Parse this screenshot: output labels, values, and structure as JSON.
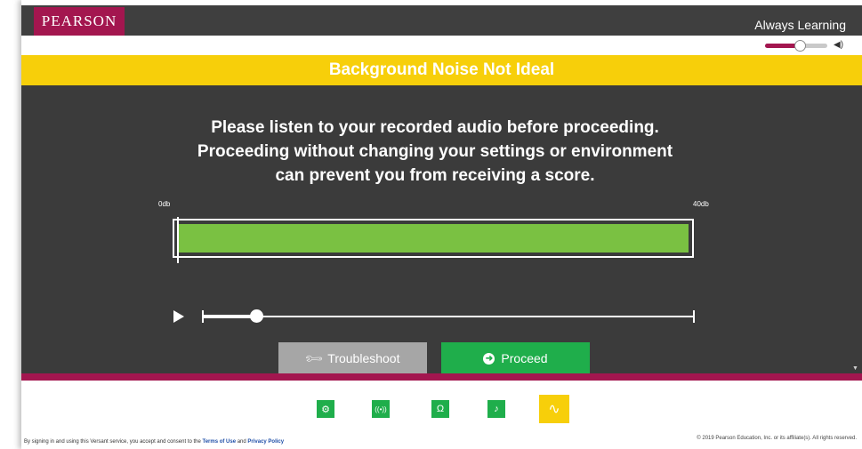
{
  "header": {
    "logo": "PEARSON",
    "tagline": "Always Learning",
    "volume": {
      "level": 0.55,
      "icon": "speaker-icon"
    }
  },
  "banner": {
    "title": "Background Noise Not Ideal"
  },
  "message": {
    "lines": [
      "Please listen to your recorded audio before proceeding.",
      "Proceeding without changing your settings or environment",
      "can prevent you from receiving a score."
    ]
  },
  "meter": {
    "min_label": "0db",
    "max_label": "40db",
    "level": 1.0,
    "color": "#7ac142"
  },
  "player": {
    "play_icon": "play-icon",
    "progress": 0.11
  },
  "buttons": {
    "troubleshoot": {
      "label": "Troubleshoot",
      "icon": "wrench-icon"
    },
    "proceed": {
      "label": "Proceed",
      "icon": "arrow-circle-icon"
    }
  },
  "footer_nav": [
    {
      "name": "settings-check-icon",
      "glyph": "⚙",
      "active": false
    },
    {
      "name": "connection-check-icon",
      "glyph": "((•))",
      "active": false
    },
    {
      "name": "headphones-check-icon",
      "glyph": "Ω",
      "active": false
    },
    {
      "name": "microphone-check-icon",
      "glyph": "♪",
      "active": false
    },
    {
      "name": "audio-waveform-icon",
      "glyph": "∿",
      "active": true
    }
  ],
  "footer": {
    "legal_prefix": "By signing in and using this Versant service, you accept and consent to the",
    "terms_link": "Terms of Use",
    "and_text": "and",
    "privacy_link": "Privacy Policy",
    "copyright": "© 2019 Pearson Education, Inc. or its affiliate(s). All rights reserved."
  },
  "colors": {
    "brand": "#a3164f",
    "banner": "#f7cf0a",
    "panel": "#3b3b3b",
    "proceed": "#1fae4b",
    "troubleshoot": "#a6a6a6"
  }
}
